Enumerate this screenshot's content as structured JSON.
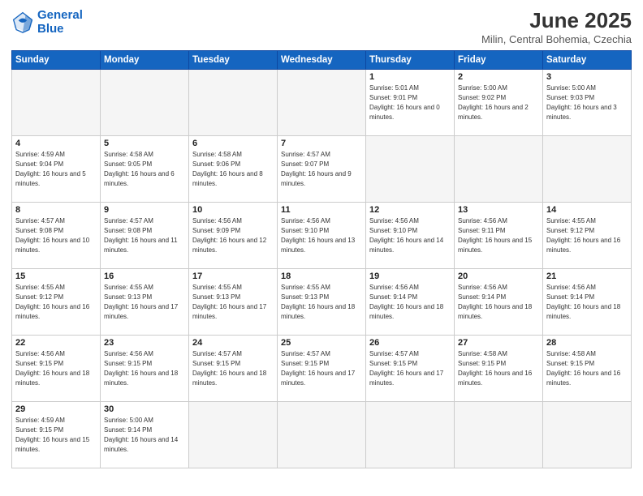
{
  "header": {
    "logo_line1": "General",
    "logo_line2": "Blue",
    "title": "June 2025",
    "subtitle": "Milin, Central Bohemia, Czechia"
  },
  "calendar": {
    "headers": [
      "Sunday",
      "Monday",
      "Tuesday",
      "Wednesday",
      "Thursday",
      "Friday",
      "Saturday"
    ],
    "weeks": [
      [
        null,
        null,
        null,
        null,
        {
          "day": 1,
          "sunrise": "5:01 AM",
          "sunset": "9:01 PM",
          "daylight": "16 hours and 0 minutes."
        },
        {
          "day": 2,
          "sunrise": "5:00 AM",
          "sunset": "9:02 PM",
          "daylight": "16 hours and 2 minutes."
        },
        {
          "day": 3,
          "sunrise": "5:00 AM",
          "sunset": "9:03 PM",
          "daylight": "16 hours and 3 minutes."
        }
      ],
      [
        {
          "day": 4,
          "sunrise": "4:59 AM",
          "sunset": "9:04 PM",
          "daylight": "16 hours and 5 minutes."
        },
        {
          "day": 5,
          "sunrise": "4:58 AM",
          "sunset": "9:05 PM",
          "daylight": "16 hours and 6 minutes."
        },
        {
          "day": 6,
          "sunrise": "4:58 AM",
          "sunset": "9:06 PM",
          "daylight": "16 hours and 8 minutes."
        },
        {
          "day": 7,
          "sunrise": "4:57 AM",
          "sunset": "9:07 PM",
          "daylight": "16 hours and 9 minutes."
        },
        null,
        null,
        null
      ],
      [
        {
          "day": 8,
          "sunrise": "4:57 AM",
          "sunset": "9:08 PM",
          "daylight": "16 hours and 10 minutes."
        },
        {
          "day": 9,
          "sunrise": "4:57 AM",
          "sunset": "9:08 PM",
          "daylight": "16 hours and 11 minutes."
        },
        {
          "day": 10,
          "sunrise": "4:56 AM",
          "sunset": "9:09 PM",
          "daylight": "16 hours and 12 minutes."
        },
        {
          "day": 11,
          "sunrise": "4:56 AM",
          "sunset": "9:10 PM",
          "daylight": "16 hours and 13 minutes."
        },
        {
          "day": 12,
          "sunrise": "4:56 AM",
          "sunset": "9:10 PM",
          "daylight": "16 hours and 14 minutes."
        },
        {
          "day": 13,
          "sunrise": "4:56 AM",
          "sunset": "9:11 PM",
          "daylight": "16 hours and 15 minutes."
        },
        {
          "day": 14,
          "sunrise": "4:55 AM",
          "sunset": "9:12 PM",
          "daylight": "16 hours and 16 minutes."
        }
      ],
      [
        {
          "day": 15,
          "sunrise": "4:55 AM",
          "sunset": "9:12 PM",
          "daylight": "16 hours and 16 minutes."
        },
        {
          "day": 16,
          "sunrise": "4:55 AM",
          "sunset": "9:13 PM",
          "daylight": "16 hours and 17 minutes."
        },
        {
          "day": 17,
          "sunrise": "4:55 AM",
          "sunset": "9:13 PM",
          "daylight": "16 hours and 17 minutes."
        },
        {
          "day": 18,
          "sunrise": "4:55 AM",
          "sunset": "9:13 PM",
          "daylight": "16 hours and 18 minutes."
        },
        {
          "day": 19,
          "sunrise": "4:56 AM",
          "sunset": "9:14 PM",
          "daylight": "16 hours and 18 minutes."
        },
        {
          "day": 20,
          "sunrise": "4:56 AM",
          "sunset": "9:14 PM",
          "daylight": "16 hours and 18 minutes."
        },
        {
          "day": 21,
          "sunrise": "4:56 AM",
          "sunset": "9:14 PM",
          "daylight": "16 hours and 18 minutes."
        }
      ],
      [
        {
          "day": 22,
          "sunrise": "4:56 AM",
          "sunset": "9:15 PM",
          "daylight": "16 hours and 18 minutes."
        },
        {
          "day": 23,
          "sunrise": "4:56 AM",
          "sunset": "9:15 PM",
          "daylight": "16 hours and 18 minutes."
        },
        {
          "day": 24,
          "sunrise": "4:57 AM",
          "sunset": "9:15 PM",
          "daylight": "16 hours and 18 minutes."
        },
        {
          "day": 25,
          "sunrise": "4:57 AM",
          "sunset": "9:15 PM",
          "daylight": "16 hours and 17 minutes."
        },
        {
          "day": 26,
          "sunrise": "4:57 AM",
          "sunset": "9:15 PM",
          "daylight": "16 hours and 17 minutes."
        },
        {
          "day": 27,
          "sunrise": "4:58 AM",
          "sunset": "9:15 PM",
          "daylight": "16 hours and 16 minutes."
        },
        {
          "day": 28,
          "sunrise": "4:58 AM",
          "sunset": "9:15 PM",
          "daylight": "16 hours and 16 minutes."
        }
      ],
      [
        {
          "day": 29,
          "sunrise": "4:59 AM",
          "sunset": "9:15 PM",
          "daylight": "16 hours and 15 minutes."
        },
        {
          "day": 30,
          "sunrise": "5:00 AM",
          "sunset": "9:14 PM",
          "daylight": "16 hours and 14 minutes."
        },
        null,
        null,
        null,
        null,
        null
      ]
    ]
  }
}
